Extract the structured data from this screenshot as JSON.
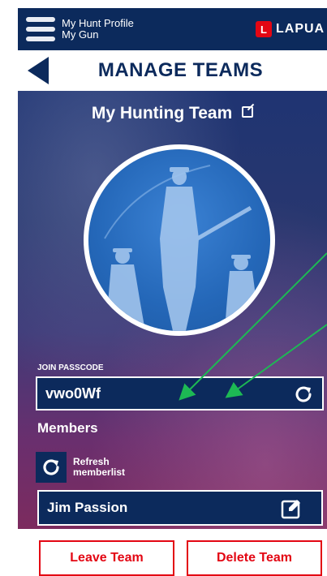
{
  "topbar": {
    "profile_line1": "My Hunt Profile",
    "profile_line2": "My Gun",
    "brand_letter": "L",
    "brand_text": "LAPUA",
    "brand_color": "#e30613"
  },
  "header": {
    "title": "MANAGE TEAMS"
  },
  "team": {
    "name": "My Hunting Team",
    "passcode_label": "JOIN PASSCODE",
    "passcode": "vwo0Wf",
    "members_title": "Members",
    "refresh_members_line1": "Refresh",
    "refresh_members_line2": "memberlist",
    "members": [
      {
        "name": "Jim Passion"
      }
    ]
  },
  "actions": {
    "leave_label": "Leave Team",
    "delete_label": "Delete Team"
  },
  "colors": {
    "navy": "#0c2a5c",
    "accent_red": "#e30613",
    "annotation_green": "#1db954"
  },
  "icons": {
    "menu": "hamburger-menu-icon",
    "back": "back-arrow-icon",
    "edit": "edit-icon",
    "refresh": "refresh-icon"
  }
}
